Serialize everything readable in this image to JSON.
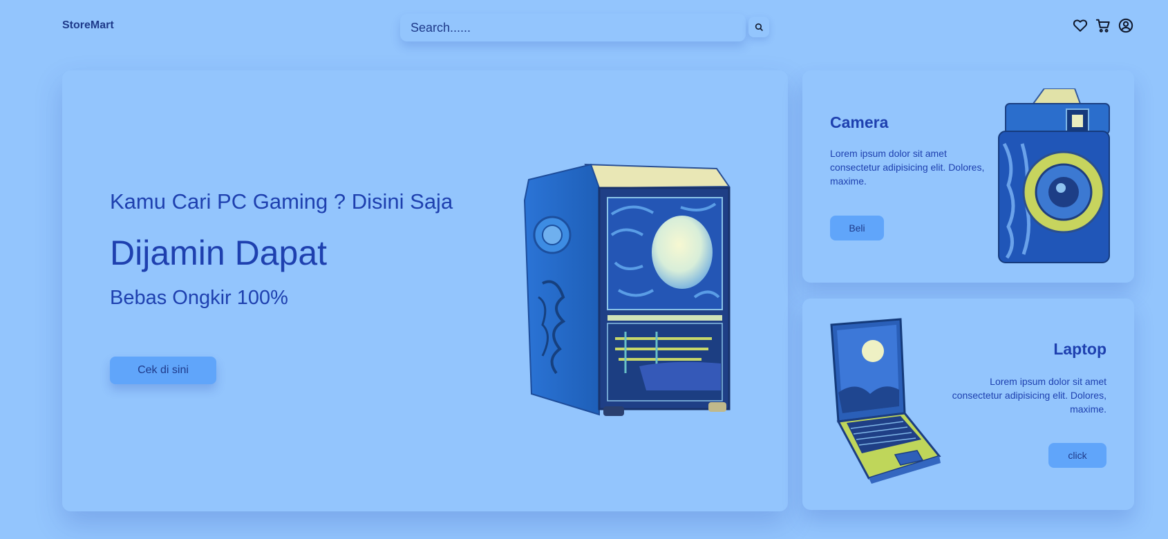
{
  "nav": {
    "brand": "StoreMart",
    "search_placeholder": "Search......",
    "icons": [
      "search-icon",
      "heart-icon",
      "cart-icon",
      "user-icon"
    ]
  },
  "hero": {
    "subtitle": "Kamu Cari PC Gaming ? Disini Saja",
    "title": "Dijamin Dapat",
    "note": "Bebas Ongkir 100%",
    "button_label": "Cek di sini"
  },
  "cards": [
    {
      "title": "Camera",
      "text": "Lorem ipsum dolor sit amet consectetur adipisicing elit. Dolores, maxime.",
      "button_label": "Beli"
    },
    {
      "title": "Laptop",
      "text": "Lorem ipsum dolor sit amet consectetur adipisicing elit. Dolores, maxime.",
      "button_label": "click"
    }
  ],
  "colors": {
    "background": "#93c5fd",
    "primary_text": "#1e40af",
    "button": "#60a5fa"
  }
}
